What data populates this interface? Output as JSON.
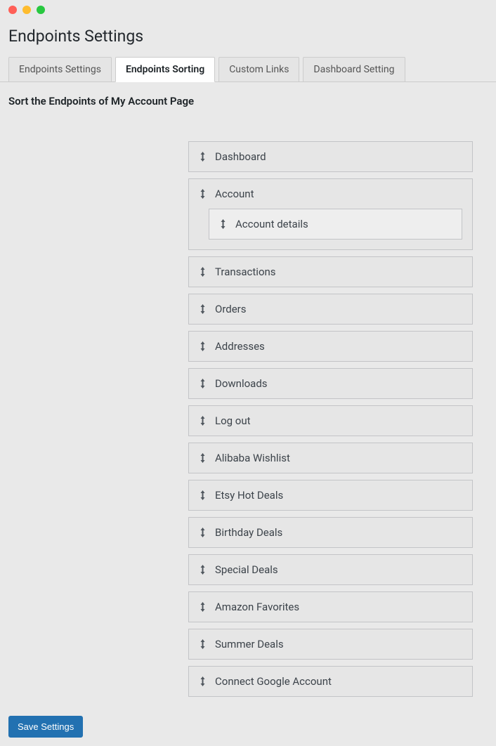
{
  "header": {
    "title": "Endpoints Settings"
  },
  "tabs": [
    {
      "label": "Endpoints Settings",
      "active": false
    },
    {
      "label": "Endpoints Sorting",
      "active": true
    },
    {
      "label": "Custom Links",
      "active": false
    },
    {
      "label": "Dashboard Setting",
      "active": false
    }
  ],
  "section": {
    "title": "Sort the Endpoints of My Account Page"
  },
  "sort_items": [
    {
      "label": "Dashboard",
      "kind": "item"
    },
    {
      "label": "Account",
      "kind": "group",
      "children": [
        {
          "label": "Account details"
        }
      ]
    },
    {
      "label": "Transactions",
      "kind": "item"
    },
    {
      "label": "Orders",
      "kind": "item"
    },
    {
      "label": "Addresses",
      "kind": "item"
    },
    {
      "label": "Downloads",
      "kind": "item"
    },
    {
      "label": "Log out",
      "kind": "item"
    },
    {
      "label": "Alibaba Wishlist",
      "kind": "item"
    },
    {
      "label": "Etsy Hot Deals",
      "kind": "item"
    },
    {
      "label": "Birthday Deals",
      "kind": "item"
    },
    {
      "label": "Special Deals",
      "kind": "item"
    },
    {
      "label": "Amazon Favorites",
      "kind": "item"
    },
    {
      "label": "Summer Deals",
      "kind": "item"
    },
    {
      "label": "Connect Google Account",
      "kind": "item"
    }
  ],
  "actions": {
    "save_label": "Save Settings"
  },
  "icons": {
    "drag": "sort-vertical-icon"
  }
}
